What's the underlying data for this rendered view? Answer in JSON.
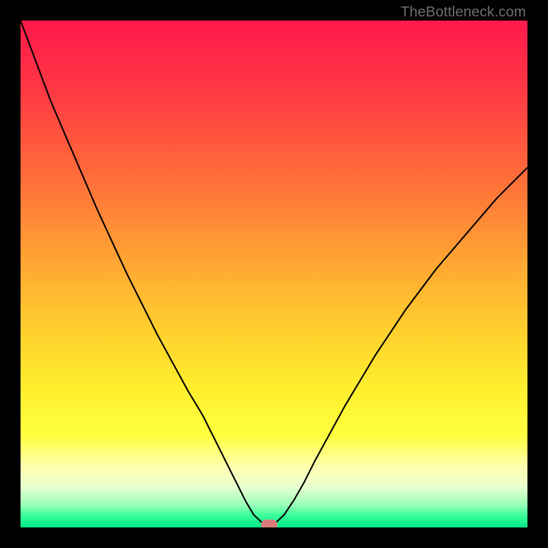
{
  "attribution": "TheBottleneck.com",
  "colors": {
    "frame_bg": "#000000",
    "curve_stroke": "#000000",
    "marker_fill": "#d97b7b",
    "gradient_stops": [
      {
        "offset": "0%",
        "color": "#ff1a4b"
      },
      {
        "offset": "12%",
        "color": "#ff3345"
      },
      {
        "offset": "30%",
        "color": "#ff6a3a"
      },
      {
        "offset": "48%",
        "color": "#ffa733"
      },
      {
        "offset": "62%",
        "color": "#ffd22e"
      },
      {
        "offset": "73%",
        "color": "#fff02e"
      },
      {
        "offset": "82%",
        "color": "#ffff40"
      },
      {
        "offset": "88%",
        "color": "#ffffb0"
      },
      {
        "offset": "92%",
        "color": "#e8ffd0"
      },
      {
        "offset": "95.5%",
        "color": "#9cffb9"
      },
      {
        "offset": "97.5%",
        "color": "#3eff9a"
      },
      {
        "offset": "100%",
        "color": "#00e888"
      }
    ]
  },
  "chart_data": {
    "type": "line",
    "title": "",
    "xlabel": "",
    "ylabel": "",
    "xlim": [
      0,
      100
    ],
    "ylim": [
      0,
      100
    ],
    "grid": false,
    "legend": false,
    "series": [
      {
        "name": "bottleneck-curve",
        "x": [
          0,
          3,
          6,
          9,
          12,
          15,
          18,
          21,
          24,
          27,
          30,
          33,
          36,
          38,
          40,
          41.5,
          43,
          44.5,
          46,
          48,
          50,
          52,
          54,
          56,
          58,
          61,
          64,
          67,
          70,
          73,
          76,
          79,
          82,
          85,
          88,
          91,
          94,
          97,
          100
        ],
        "y": [
          100,
          92,
          84,
          77,
          70,
          63,
          56.5,
          50,
          44,
          38,
          32.5,
          27,
          22,
          18,
          14,
          11,
          8,
          5,
          2.5,
          0.6,
          0.6,
          2.5,
          5.5,
          9,
          13,
          18.5,
          24,
          29,
          34,
          38.5,
          43,
          47,
          51,
          54.5,
          58,
          61.5,
          65,
          68,
          71
        ]
      }
    ],
    "marker": {
      "x": 49,
      "y": 0.6
    }
  }
}
